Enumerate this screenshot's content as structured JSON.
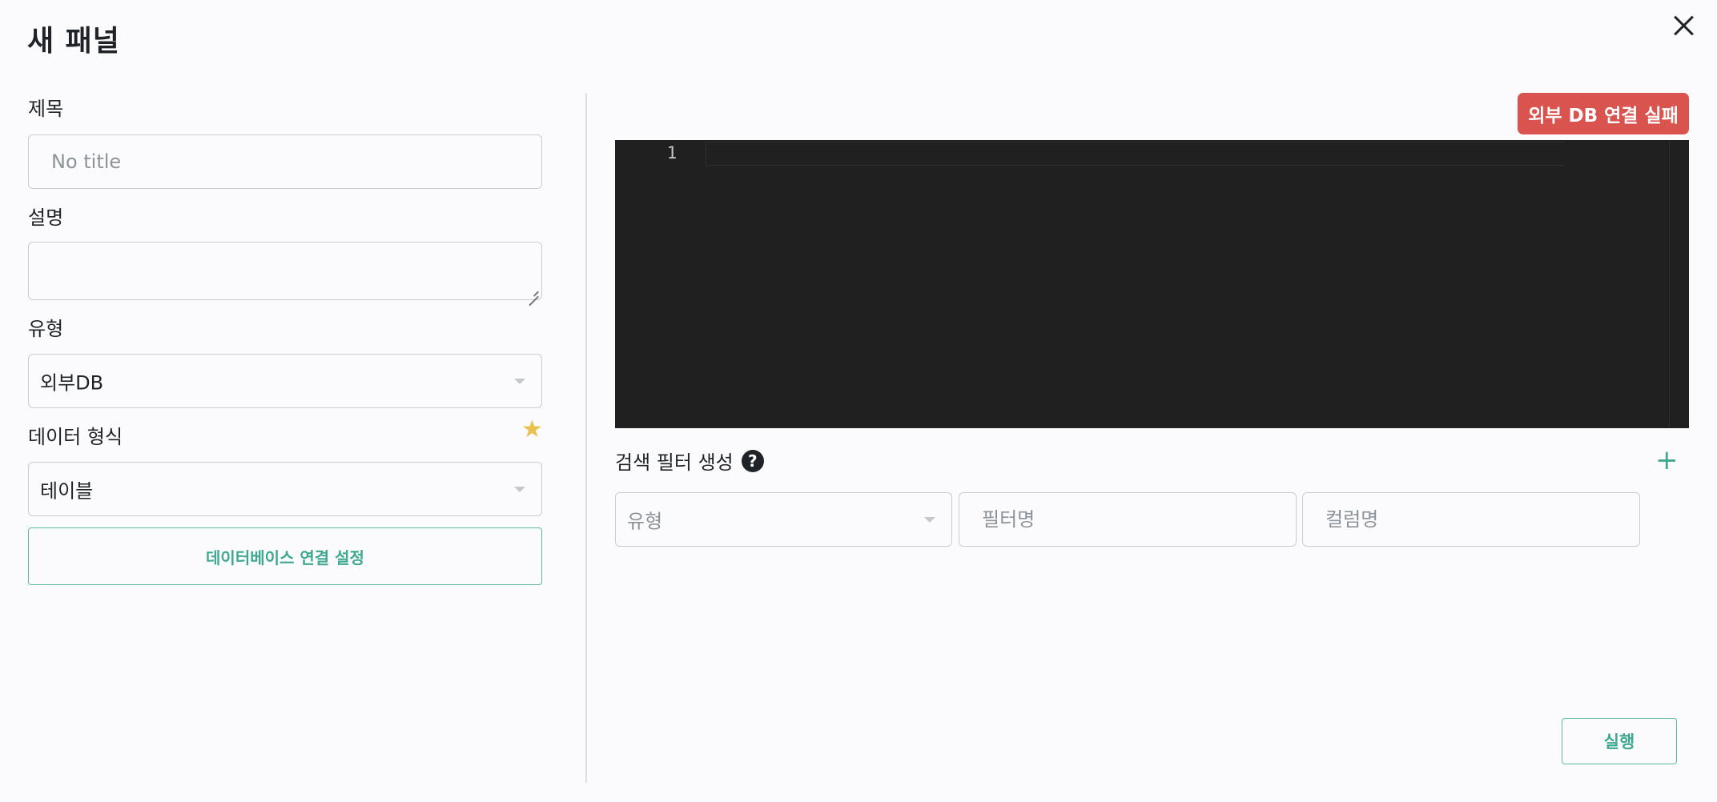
{
  "dialog": {
    "title": "새 패널"
  },
  "form": {
    "title_label": "제목",
    "title_placeholder": "No title",
    "description_label": "설명",
    "type_label": "유형",
    "type_value": "외부DB",
    "format_label": "데이터 형식",
    "format_value": "테이블",
    "db_settings_button": "데이터베이스 연결 설정"
  },
  "editor": {
    "status_badge": "외부 DB 연결 실패",
    "line_numbers": [
      "1"
    ]
  },
  "filters": {
    "title": "검색 필터 생성",
    "help_glyph": "?",
    "add_glyph": "+",
    "type_placeholder": "유형",
    "filter_name_placeholder": "필터명",
    "column_name_placeholder": "컬럼명"
  },
  "actions": {
    "run_label": "실행"
  },
  "icons": {
    "close": "close-icon",
    "star": "star-icon",
    "help": "question-circle-icon",
    "add": "plus-icon",
    "caret": "chevron-down-icon"
  },
  "colors": {
    "accent": "#3fa891",
    "error": "#d9534f",
    "editor_bg": "#202020",
    "star": "#e8c14e"
  }
}
